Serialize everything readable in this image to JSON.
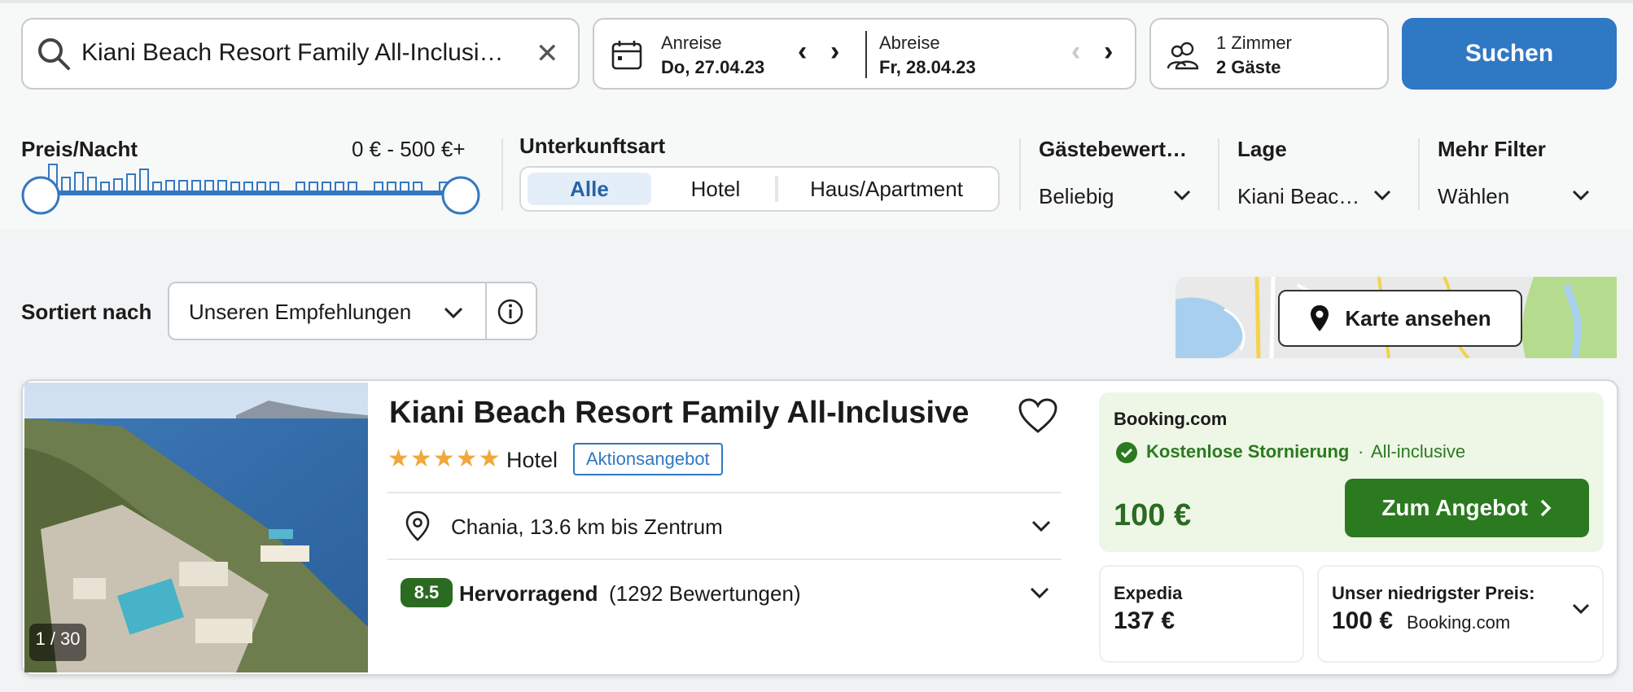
{
  "search": {
    "query": "Kiani Beach Resort Family All-Inclusi…",
    "clear_icon": "close-icon"
  },
  "dates": {
    "checkin_label": "Anreise",
    "checkin_value": "Do, 27.04.23",
    "checkout_label": "Abreise",
    "checkout_value": "Fr, 28.04.23"
  },
  "guests": {
    "rooms": "1 Zimmer",
    "guests": "2 Gäste"
  },
  "search_button": "Suchen",
  "filters": {
    "price_title": "Preis/Nacht",
    "price_range": "0 € - 500 €+",
    "accommodation_title": "Unterkunftsart",
    "accommodation_options": [
      "Alle",
      "Hotel",
      "Haus/Apartment"
    ],
    "rating_title": "Gästebewert…",
    "rating_value": "Beliebig",
    "location_title": "Lage",
    "location_value": "Kiani Beac…",
    "more_title": "Mehr Filter",
    "more_value": "Wählen"
  },
  "sort": {
    "label": "Sortiert nach",
    "value": "Unseren Empfehlungen"
  },
  "map_button": "Karte ansehen",
  "hotel": {
    "image_counter": "1 / 30",
    "name": "Kiani Beach Resort Family All-Inclusive",
    "stars": "★★★★★",
    "type": "Hotel",
    "promo": "Aktionsangebot",
    "location": "Chania, 13.6 km bis Zentrum",
    "rating_score": "8.5",
    "rating_label": "Hervorragend",
    "rating_count": "(1292 Bewertungen)"
  },
  "offer": {
    "provider": "Booking.com",
    "cancel": "Kostenlose Stornierung",
    "dot": "·",
    "board": "All-inclusive",
    "price": "100 €",
    "cta": "Zum Angebot"
  },
  "alt_offer": {
    "provider": "Expedia",
    "price": "137 €"
  },
  "lowest": {
    "label": "Unser niedrigster Preis:",
    "price": "100 €",
    "provider": "Booking.com"
  },
  "colors": {
    "accent": "#2f78c4",
    "green": "#2b7a1f",
    "star": "#f0a83a"
  }
}
